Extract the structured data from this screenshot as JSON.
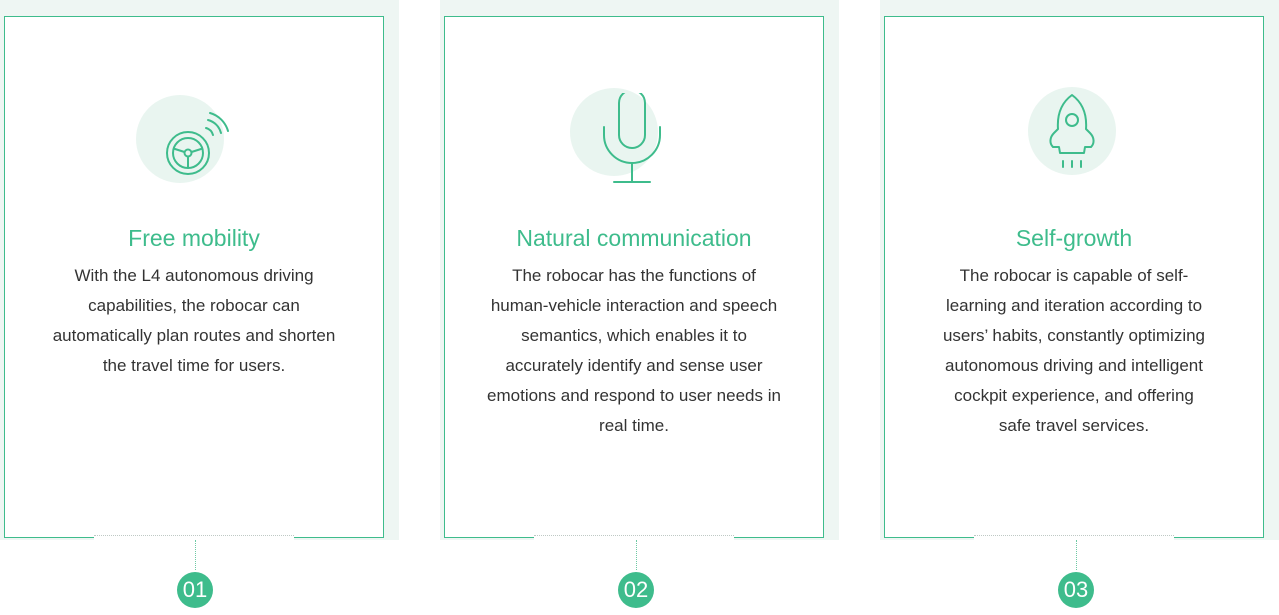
{
  "cards": [
    {
      "title": "Free mobility",
      "text": "With the L4 autonomous driving capabilities, the robocar can automatically plan routes and shorten the travel time for users.",
      "number": "01",
      "icon": "steering-wheel-icon"
    },
    {
      "title": "Natural communication",
      "text": "The robocar has the functions of human-vehicle interaction and speech semantics, which enables it to accurately identify and sense user emotions and respond to user needs in real time.",
      "number": "02",
      "icon": "microphone-icon"
    },
    {
      "title": "Self-growth",
      "text": "The robocar is capable of self-learning and iteration according to users’ habits, constantly optimizing autonomous driving and intelligent cockpit experience, and offering safe travel services.",
      "number": "03",
      "icon": "rocket-icon"
    }
  ],
  "colors": {
    "accent": "#3ebc8c",
    "panel_bg": "#eef6f3",
    "icon_circle": "#e9f5f0",
    "text": "#333333"
  }
}
